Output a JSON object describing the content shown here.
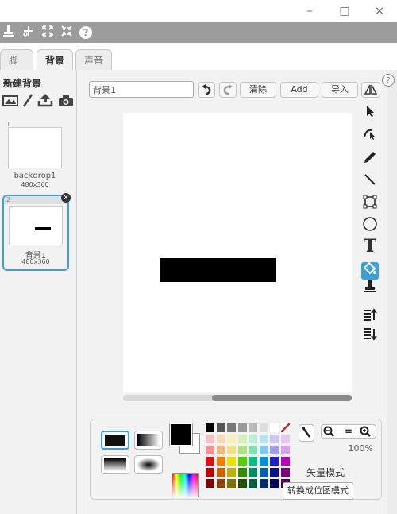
{
  "window": {
    "minimize": "–",
    "maximize": "□",
    "close": "×"
  },
  "toolbar": {
    "icons": [
      "stamp-icon",
      "cut-icon",
      "grow-icon",
      "shrink-icon",
      "help-icon"
    ],
    "help_glyph": "?"
  },
  "tabs": {
    "scripts": "脚本",
    "backdrops": "背景",
    "sounds": "声音"
  },
  "sidebar": {
    "new_backdrop_label": "新建背景",
    "items": [
      {
        "index": "1",
        "name": "backdrop1",
        "size": "480x360"
      },
      {
        "index": "2",
        "name": "背景1",
        "size": "480x360"
      }
    ]
  },
  "editor": {
    "costume_name": "背景1",
    "clear_label": "清除",
    "add_label": "Add",
    "import_label": "导入",
    "zoom_level": "100%",
    "mode_label": "矢量模式",
    "convert_label": "转换成位图模式",
    "help_glyph": "?"
  },
  "colors": {
    "primary": "#000000",
    "secondary": "#ffffff",
    "selection": "#3aa0d8",
    "palette": [
      [
        "#000000",
        "#555555",
        "#777777",
        "#999999",
        "#bbbbbb",
        "#dddddd",
        "#ffffff",
        "#ffffff"
      ],
      [
        "#f5c0c0",
        "#f8d8b8",
        "#f8f0b8",
        "#d8f0b8",
        "#b8f0d8",
        "#b8e0f0",
        "#c8c8f0",
        "#e8c8f0"
      ],
      [
        "#f09090",
        "#f0b880",
        "#f0e080",
        "#b0e080",
        "#80e0b0",
        "#80c8e8",
        "#a0a0e8",
        "#d8a0e8"
      ],
      [
        "#e01010",
        "#f08000",
        "#f0e000",
        "#50d000",
        "#00c080",
        "#0090e0",
        "#2020d0",
        "#c000c0"
      ],
      [
        "#c00000",
        "#d06000",
        "#c0b000",
        "#309000",
        "#009060",
        "#0060b0",
        "#101090",
        "#800080"
      ],
      [
        "#800000",
        "#904000",
        "#807000",
        "#205000",
        "#006040",
        "#003070",
        "#000060",
        "#500050"
      ]
    ]
  }
}
